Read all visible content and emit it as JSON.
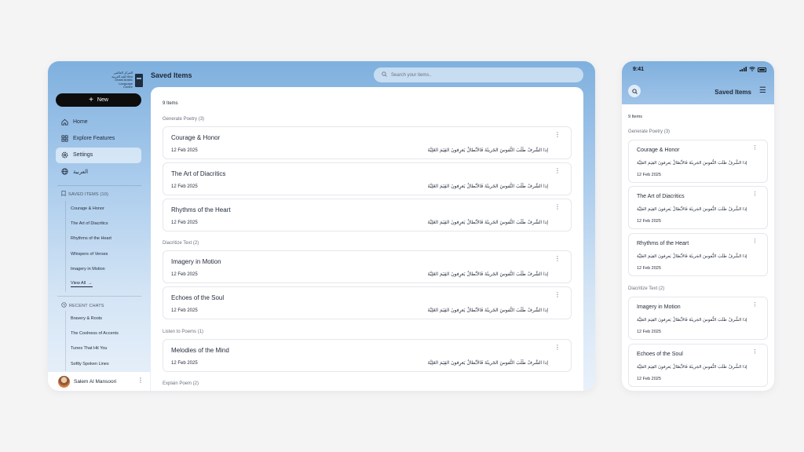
{
  "desktop": {
    "logo_text": "المركز العالمي للغة العربية Abu Dhabi Arabic Language Centre",
    "new_button_label": "New",
    "nav": [
      {
        "label": "Home",
        "icon": "home-icon"
      },
      {
        "label": "Explore Features",
        "icon": "grid-icon"
      },
      {
        "label": "Settings",
        "icon": "gear-icon",
        "active": true
      },
      {
        "label": "العربية",
        "icon": "globe-icon"
      }
    ],
    "saved_items_heading": "SAVED ITEMS (10)",
    "saved_items": [
      "Courage & Honor",
      "The Art of Diacritics",
      "Rhythms of the Heart",
      "Whispers of Verses",
      "Imagery in Motion"
    ],
    "view_all_label": "View All",
    "recent_chats_heading": "RECENT CHATS",
    "recent_chats": [
      "Bravery & Roots",
      "The Coolness of Accents",
      "Tunes That Hit You",
      "Softly Spoken Lines"
    ],
    "user_name": "Salem Al Mansoori",
    "page_title": "Saved Items",
    "search_placeholder": "Search your items..",
    "count_label": "9 Items",
    "groups": [
      {
        "title": "Generate Poetry (3)",
        "items": [
          {
            "title": "Courage & Honor",
            "date": "12 Feb 2025",
            "arabic": "إذا الشَّرفُ طَلَبَ النُّفوسَ الجَريئَةَ فَالأبْطالُ يَعرِفونَ القِيَمَ العَلِيَّةَ"
          },
          {
            "title": "The Art of Diacritics",
            "date": "12 Feb 2025",
            "arabic": "إذا الشَّرفُ طَلَبَ النُّفوسَ الجَريئَةَ فَالأبْطالُ يَعرِفونَ القِيَمَ العَلِيَّةَ"
          },
          {
            "title": "Rhythms of the Heart",
            "date": "12 Feb 2025",
            "arabic": "إذا الشَّرفُ طَلَبَ النُّفوسَ الجَريئَةَ فَالأبْطالُ يَعرِفونَ القِيَمَ العَلِيَّةَ"
          }
        ]
      },
      {
        "title": "Diacritize Text (2)",
        "items": [
          {
            "title": "Imagery in Motion",
            "date": "12 Feb 2025",
            "arabic": "إذا الشَّرفُ طَلَبَ النُّفوسَ الجَريئَةَ فَالأبْطالُ يَعرِفونَ القِيَمَ العَلِيَّةَ"
          },
          {
            "title": "Echoes of the Soul",
            "date": "12 Feb 2025",
            "arabic": "إذا الشَّرفُ طَلَبَ النُّفوسَ الجَريئَةَ فَالأبْطالُ يَعرِفونَ القِيَمَ العَلِيَّةَ"
          }
        ]
      },
      {
        "title": "Listen to Poems (1)",
        "items": [
          {
            "title": "Melodies of the Mind",
            "date": "12 Feb 2025",
            "arabic": "إذا الشَّرفُ طَلَبَ النُّفوسَ الجَريئَةَ فَالأبْطالُ يَعرِفونَ القِيَمَ العَلِيَّةَ"
          }
        ]
      },
      {
        "title": "Explain Poem (2)",
        "items": []
      }
    ]
  },
  "mobile": {
    "time": "9:41",
    "title": "Saved Items",
    "count_label": "9 Items",
    "groups": [
      {
        "title": "Generate Poetry (3)",
        "items": [
          {
            "title": "Courage & Honor",
            "date": "12 Feb 2025",
            "arabic": "إذا الشَّرفُ طَلَبَ النُّفوسَ الجَريئَةَ فَالأبْطالُ يَعرِفونَ القِيَمَ العَلِيَّةَ"
          },
          {
            "title": "The Art of Diacritics",
            "date": "12 Feb 2025",
            "arabic": "إذا الشَّرفُ طَلَبَ النُّفوسَ الجَريئَةَ فَالأبْطالُ يَعرِفونَ القِيَمَ العَلِيَّةَ"
          },
          {
            "title": "Rhythms of the Heart",
            "date": "12 Feb 2025",
            "arabic": "إذا الشَّرفُ طَلَبَ النُّفوسَ الجَريئَةَ فَالأبْطالُ يَعرِفونَ القِيَمَ العَلِيَّةَ"
          }
        ]
      },
      {
        "title": "Diacritize Text (2)",
        "items": [
          {
            "title": "Imagery in Motion",
            "date": "12 Feb 2025",
            "arabic": "إذا الشَّرفُ طَلَبَ النُّفوسَ الجَريئَةَ فَالأبْطالُ يَعرِفونَ القِيَمَ العَلِيَّةَ"
          },
          {
            "title": "Echoes of the Soul",
            "date": "12 Feb 2025",
            "arabic": "إذا الشَّرفُ طَلَبَ النُّفوسَ الجَريئَةَ فَالأبْطالُ يَعرِفونَ القِيَمَ العَلِيَّةَ"
          }
        ]
      }
    ]
  },
  "colors": {
    "accent_blue": "#7fb0de",
    "button_dark": "#0d0d0d",
    "card_border": "#e5e7eb"
  }
}
